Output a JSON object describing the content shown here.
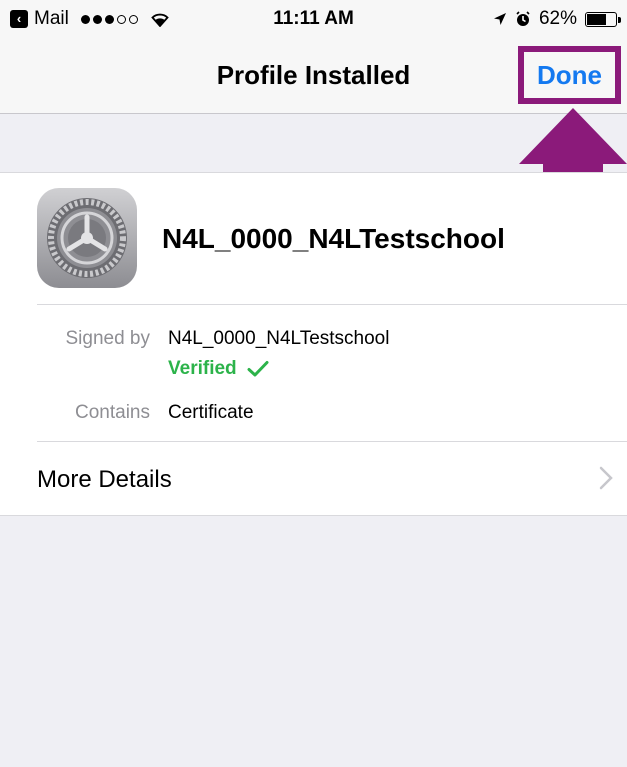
{
  "status_bar": {
    "back_app": "Mail",
    "time": "11:11 AM",
    "battery": "62%",
    "battery_level": 0.62,
    "signal_bars_filled": 3,
    "signal_bars_total": 5
  },
  "nav": {
    "title": "Profile Installed",
    "done_label": "Done"
  },
  "profile": {
    "name": "N4L_0000_N4LTestschool",
    "icon": "settings-gear-icon",
    "signed_by_label": "Signed by",
    "signed_by_value": "N4L_0000_N4LTestschool",
    "verified_label": "Verified",
    "contains_label": "Contains",
    "contains_value": "Certificate"
  },
  "more_details": {
    "label": "More Details"
  },
  "colors": {
    "accent": "#1479f0",
    "verified": "#2cb34a",
    "highlight": "#8b1a7a"
  }
}
